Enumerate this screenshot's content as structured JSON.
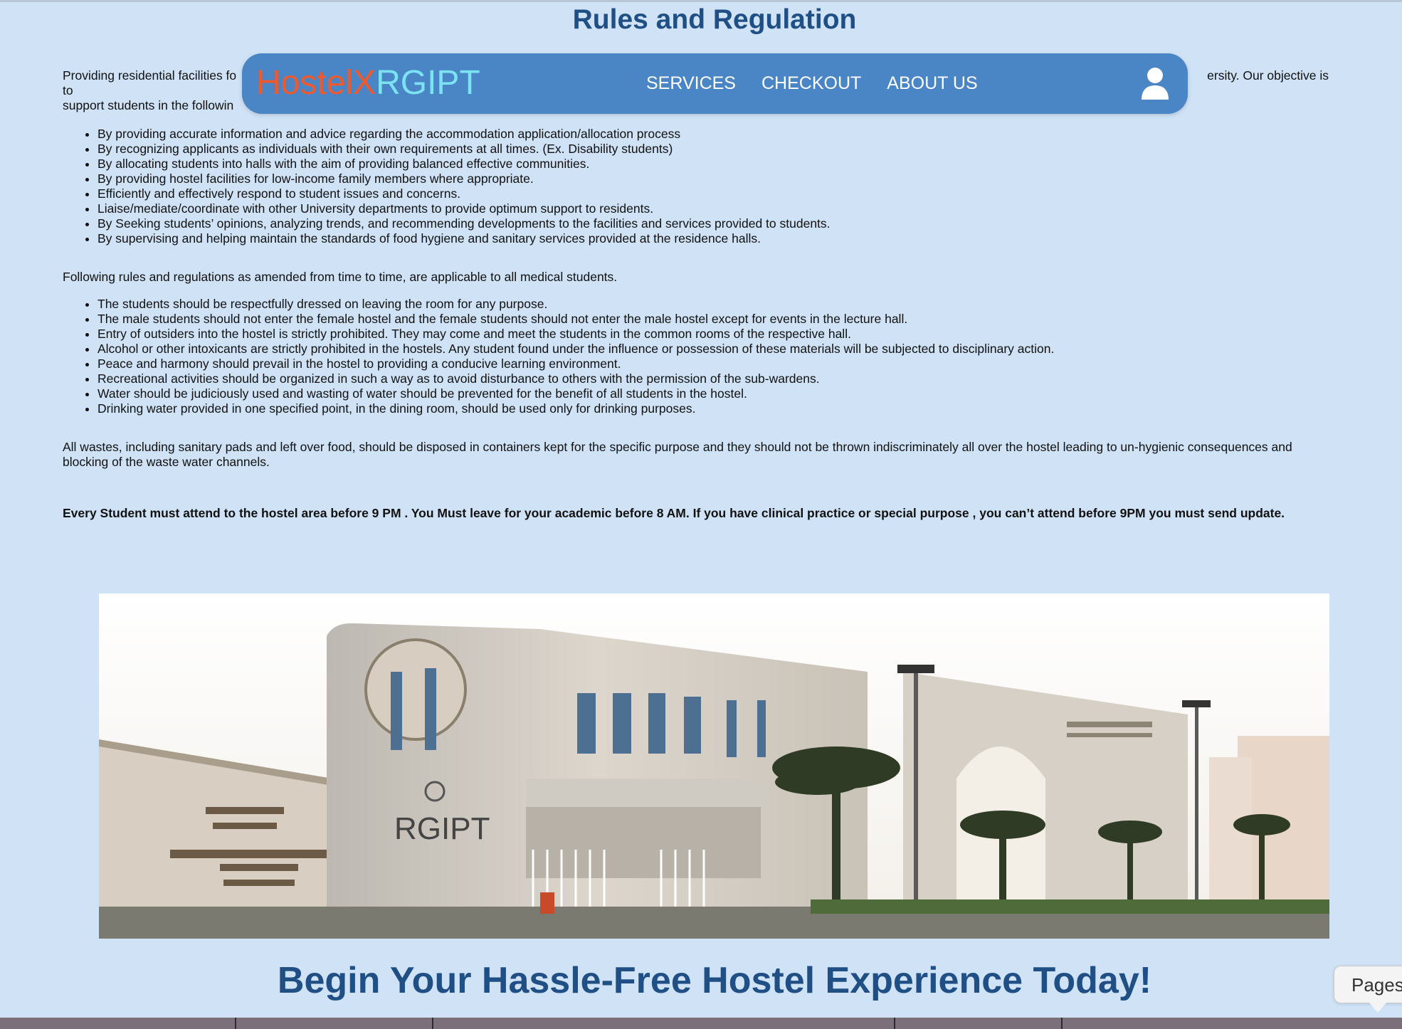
{
  "page": {
    "title": "Rules and Regulation",
    "cta": "Begin Your Hassle-Free Hostel Experience Today!"
  },
  "navbar": {
    "logo_part1": "HostelX",
    "logo_part2": "RGIPT",
    "links": [
      "SERVICES",
      "CHECKOUT",
      "ABOUT US"
    ],
    "user_icon": "user-icon"
  },
  "content": {
    "intro_visible_1": "Providing residential facilities fo",
    "intro_visible_2": "ersity. Our objective is to",
    "intro_line2": "support students in the followin",
    "objectives": [
      "By providing accurate information and advice regarding the accommodation application/allocation process",
      "By recognizing applicants as individuals with their own requirements at all times. (Ex. Disability students)",
      "By allocating students into halls with the aim of providing balanced effective communities.",
      "By providing hostel facilities for low-income family members where appropriate.",
      "Efficiently and effectively respond to student issues and concerns.",
      "Liaise/mediate/coordinate with other University departments to provide optimum support to residents.",
      "By Seeking students’ opinions, analyzing trends, and recommending developments to the facilities and services provided to students.",
      "By supervising and helping maintain the standards of food hygiene and sanitary services provided at the residence halls."
    ],
    "rules_intro": "Following rules and regulations as amended from time to time, are applicable to all medical students.",
    "rules": [
      "The students should be respectfully dressed on leaving the room for any purpose.",
      "The male students should not enter the female hostel and the female students should not enter the male hostel except for events in the lecture hall.",
      "Entry of outsiders into the hostel is strictly prohibited.  They may come and meet the students in the common rooms of the respective hall.",
      "Alcohol or other intoxicants are strictly prohibited in the hostels.  Any student found under the influence or possession of these materials will be subjected to disciplinary action.",
      "Peace and harmony should prevail in the hostel to providing a conducive learning environment.",
      "Recreational activities should be organized in such a way as to avoid disturbance to others with the permission of the sub-wardens.",
      "Water should be judiciously used and wasting of water should be prevented for the benefit of all students in the hostel.",
      "Drinking water provided in one specified point, in the dining room, should be used only for drinking purposes."
    ],
    "waste_note": "All wastes, including sanitary pads and left over food, should be disposed in containers kept for the specific purpose and they should not be thrown indiscriminately all over the hostel leading to un-hygienic consequences and blocking of the waste water channels.",
    "timing_note": "Every Student must attend to the hostel area before 9 PM . You Must leave for your academic before 8 AM. If you have clinical practice or special purpose , you can’t attend before 9PM you must send update."
  },
  "hero": {
    "sign_text": "RGIPT"
  },
  "overlay": {
    "pages_label": "Pages"
  }
}
